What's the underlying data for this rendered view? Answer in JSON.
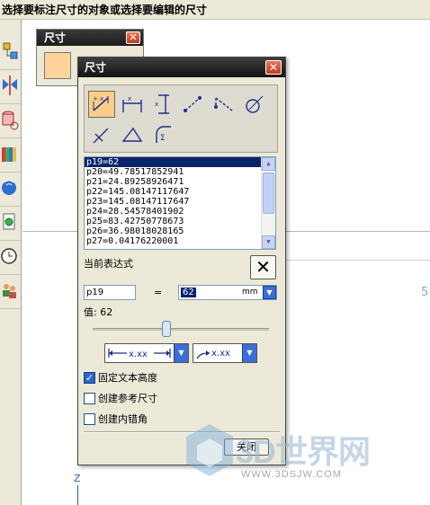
{
  "status_bar": {
    "text": "选择要标注尺寸的对象或选择要编辑的尺寸"
  },
  "left_toolbar": {
    "icons": [
      "assembly-icon",
      "mirror-icon",
      "cylinder-icon",
      "books-icon",
      "network-icon",
      "document-icon",
      "clock-icon",
      "users-icon"
    ]
  },
  "back_dialog": {
    "title": "尺寸"
  },
  "dialog": {
    "title": "尺寸",
    "dimension_types": [
      "inferred-dimension-icon",
      "horizontal-dimension-icon",
      "vertical-dimension-icon",
      "parallel-dimension-icon",
      "perpendicular-dimension-icon",
      "diameter-dimension-icon",
      "chamfer-dimension-icon",
      "angular-dimension-icon",
      "radius-dimension-icon"
    ],
    "expressions": [
      "p19=62",
      "p20=49.78517852941",
      "p21=24.89258926471",
      "p22=145.08147117647",
      "p23=145.08147117647",
      "p24=28.54578401902",
      "p25=83.42750778673",
      "p26=36.98018028165",
      "p27=0.04176220001"
    ],
    "current_expression_label": "当前表达式",
    "expression_name": "p19",
    "equals": "=",
    "expression_value": "62",
    "unit": "mm",
    "value_label": "值: 62",
    "slider_fraction": 0.42,
    "style_dropdown_1": "x.xx",
    "style_dropdown_2": "x.xx",
    "checkboxes": [
      {
        "label": "固定文本高度",
        "checked": true
      },
      {
        "label": "创建参考尺寸",
        "checked": false
      },
      {
        "label": "创建内错角",
        "checked": false
      }
    ],
    "close_label": "关闭"
  },
  "canvas": {
    "axis_label": "Z",
    "marker": "5"
  },
  "watermark": {
    "brand": "3D世界网",
    "url": "WWW.3DSJW.COM"
  },
  "colors": {
    "selection": "#0a246a",
    "title_bar": "#1c1c1c",
    "selected_icon_bg": "#ffcd86",
    "dropdown_blue": "#3c6fd6"
  }
}
